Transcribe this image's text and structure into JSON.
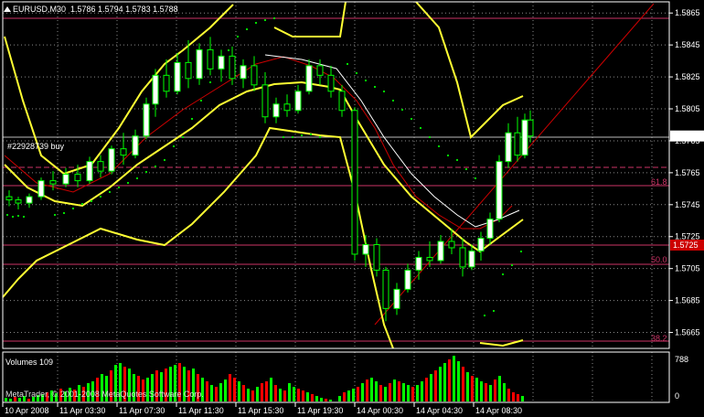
{
  "header": {
    "symbol_tf": "EURUSD,M30",
    "ohlc": "1.5786 1.5794 1.5783 1.5788"
  },
  "order_label": "#22928739 buy",
  "fib_labels": [
    "61.8",
    "50.0",
    "38.2"
  ],
  "price_ticks": [
    "1.5865",
    "1.5845",
    "1.5825",
    "1.5805",
    "1.5785",
    "1.5765",
    "1.5745",
    "1.5725",
    "1.5705",
    "1.5685",
    "1.5665"
  ],
  "current_price": "1.5788",
  "red_price_tag": "1.5725",
  "volume_panel": {
    "title": "Volumes 109",
    "max_tick": "788",
    "zero_tick": "0",
    "watermark": "MetaTrader, © 2001-2008 MetaQuotes Software Corp."
  },
  "time_ticks": [
    "10 Apr 2008",
    "11 Apr 03:30",
    "11 Apr 07:30",
    "11 Apr 11:30",
    "11 Apr 15:30",
    "11 Apr 19:30",
    "14 Apr 00:30",
    "14 Apr 04:30",
    "14 Apr 08:30"
  ],
  "colors": {
    "background": "#000000",
    "grid": "#8a8a8a",
    "candle_bull": "#ffffff",
    "candle_bear": "#000000",
    "bar_outline": "#00ff00",
    "bands": "#ffff33",
    "ma_red": "#cc0000",
    "ma_white": "#ffffff",
    "sar": "#00dd00",
    "fib_lines": "#cc3366",
    "vol_up": "#00ff00",
    "vol_down": "#ff0000"
  },
  "chart_data": {
    "type": "candlestick",
    "symbol": "EURUSD",
    "timeframe": "M30",
    "ylim": [
      1.5655,
      1.5872
    ],
    "candles_approx": [
      [
        1.575,
        1.5754,
        1.5744,
        1.5748
      ],
      [
        1.5748,
        1.575,
        1.5742,
        1.5746
      ],
      [
        1.5746,
        1.5752,
        1.5743,
        1.575
      ],
      [
        1.575,
        1.5762,
        1.5748,
        1.576
      ],
      [
        1.576,
        1.5766,
        1.5754,
        1.5758
      ],
      [
        1.5758,
        1.5768,
        1.5756,
        1.5764
      ],
      [
        1.5764,
        1.577,
        1.5756,
        1.576
      ],
      [
        1.576,
        1.5775,
        1.5758,
        1.5772
      ],
      [
        1.5772,
        1.5776,
        1.5762,
        1.5766
      ],
      [
        1.5766,
        1.5782,
        1.5764,
        1.578
      ],
      [
        1.578,
        1.579,
        1.577,
        1.5776
      ],
      [
        1.5776,
        1.5792,
        1.5774,
        1.5788
      ],
      [
        1.5788,
        1.5812,
        1.5786,
        1.5808
      ],
      [
        1.5808,
        1.583,
        1.58,
        1.5826
      ],
      [
        1.5826,
        1.5836,
        1.5812,
        1.5816
      ],
      [
        1.5816,
        1.584,
        1.5814,
        1.5834
      ],
      [
        1.5834,
        1.5848,
        1.5818,
        1.5824
      ],
      [
        1.5824,
        1.5846,
        1.582,
        1.5842
      ],
      [
        1.5842,
        1.585,
        1.5826,
        1.583
      ],
      [
        1.583,
        1.5842,
        1.5822,
        1.5838
      ],
      [
        1.5838,
        1.5844,
        1.582,
        1.5824
      ],
      [
        1.5824,
        1.5836,
        1.5818,
        1.5832
      ],
      [
        1.5832,
        1.5838,
        1.5816,
        1.582
      ],
      [
        1.582,
        1.5828,
        1.5796,
        1.58
      ],
      [
        1.58,
        1.5812,
        1.5796,
        1.5808
      ],
      [
        1.5808,
        1.5814,
        1.58,
        1.5804
      ],
      [
        1.5804,
        1.582,
        1.5802,
        1.5816
      ],
      [
        1.5816,
        1.5836,
        1.5814,
        1.5832
      ],
      [
        1.5832,
        1.5836,
        1.582,
        1.5826
      ],
      [
        1.5826,
        1.5832,
        1.5812,
        1.5816
      ],
      [
        1.5816,
        1.582,
        1.58,
        1.5804
      ],
      [
        1.5804,
        1.5806,
        1.571,
        1.5714
      ],
      [
        1.5714,
        1.5726,
        1.5706,
        1.572
      ],
      [
        1.572,
        1.5724,
        1.57,
        1.5704
      ],
      [
        1.5704,
        1.5706,
        1.5672,
        1.568
      ],
      [
        1.568,
        1.5696,
        1.5676,
        1.5692
      ],
      [
        1.5692,
        1.5708,
        1.569,
        1.5704
      ],
      [
        1.5704,
        1.5716,
        1.5698,
        1.5712
      ],
      [
        1.5712,
        1.5722,
        1.5706,
        1.571
      ],
      [
        1.571,
        1.5726,
        1.5708,
        1.5722
      ],
      [
        1.5722,
        1.573,
        1.5714,
        1.5718
      ],
      [
        1.5718,
        1.5724,
        1.57,
        1.5706
      ],
      [
        1.5706,
        1.572,
        1.5704,
        1.5716
      ],
      [
        1.5716,
        1.5728,
        1.571,
        1.5724
      ],
      [
        1.5724,
        1.574,
        1.572,
        1.5736
      ],
      [
        1.5736,
        1.5776,
        1.5734,
        1.5772
      ],
      [
        1.5772,
        1.5796,
        1.5768,
        1.579
      ],
      [
        1.579,
        1.58,
        1.5772,
        1.5776
      ],
      [
        1.5776,
        1.5802,
        1.5774,
        1.5798
      ],
      [
        1.5798,
        1.5804,
        1.5784,
        1.5788
      ]
    ]
  }
}
